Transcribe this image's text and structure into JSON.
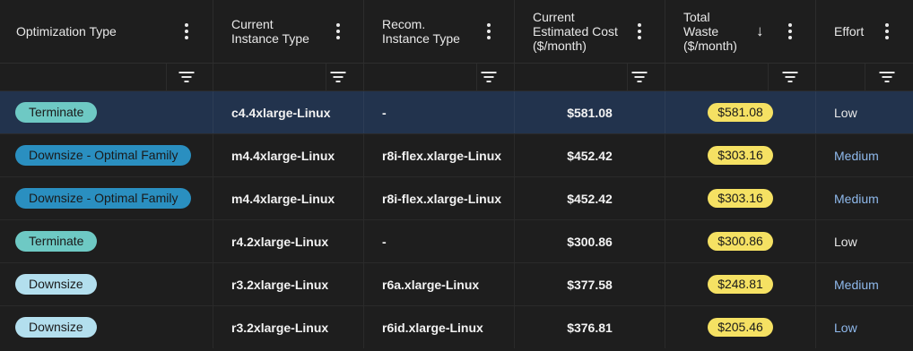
{
  "header": {
    "columns": [
      {
        "label": "Optimization Type"
      },
      {
        "label": "Current\nInstance Type"
      },
      {
        "label": "Recom.\nInstance Type"
      },
      {
        "label": "Current\nEstimated Cost\n($/month)"
      },
      {
        "label": "Total\nWaste\n($/month)",
        "sorted": "descending"
      },
      {
        "label": "Effort"
      }
    ]
  },
  "rows": [
    {
      "type": "Terminate",
      "type_color": "#6ec9c4",
      "current": "c4.4xlarge-Linux",
      "recommended": "-",
      "cost": "$581.08",
      "waste": "$581.08",
      "effort": "Low",
      "effort_color": "#e8e8e8",
      "selected": true
    },
    {
      "type": "Downsize - Optimal Family",
      "type_color": "#2a8fc0",
      "current": "m4.4xlarge-Linux",
      "recommended": "r8i-flex.xlarge-Linux",
      "cost": "$452.42",
      "waste": "$303.16",
      "effort": "Medium",
      "effort_color": "#8fb9ec",
      "selected": false
    },
    {
      "type": "Downsize - Optimal Family",
      "type_color": "#2a8fc0",
      "current": "m4.4xlarge-Linux",
      "recommended": "r8i-flex.xlarge-Linux",
      "cost": "$452.42",
      "waste": "$303.16",
      "effort": "Medium",
      "effort_color": "#8fb9ec",
      "selected": false
    },
    {
      "type": "Terminate",
      "type_color": "#6ec9c4",
      "current": "r4.2xlarge-Linux",
      "recommended": "-",
      "cost": "$300.86",
      "waste": "$300.86",
      "effort": "Low",
      "effort_color": "#e8e8e8",
      "selected": false
    },
    {
      "type": "Downsize",
      "type_color": "#b3dfee",
      "current": "r3.2xlarge-Linux",
      "recommended": "r6a.xlarge-Linux",
      "cost": "$377.58",
      "waste": "$248.81",
      "effort": "Medium",
      "effort_color": "#8fb9ec",
      "selected": false
    },
    {
      "type": "Downsize",
      "type_color": "#b3dfee",
      "current": "r3.2xlarge-Linux",
      "recommended": "r6id.xlarge-Linux",
      "cost": "$376.81",
      "waste": "$205.46",
      "effort": "Low",
      "effort_color": "#8fb9ec",
      "selected": false
    }
  ],
  "icons": {
    "column_menu": "kebab-menu-icon",
    "filter": "filter-icon",
    "sort": "arrow-down-icon"
  }
}
